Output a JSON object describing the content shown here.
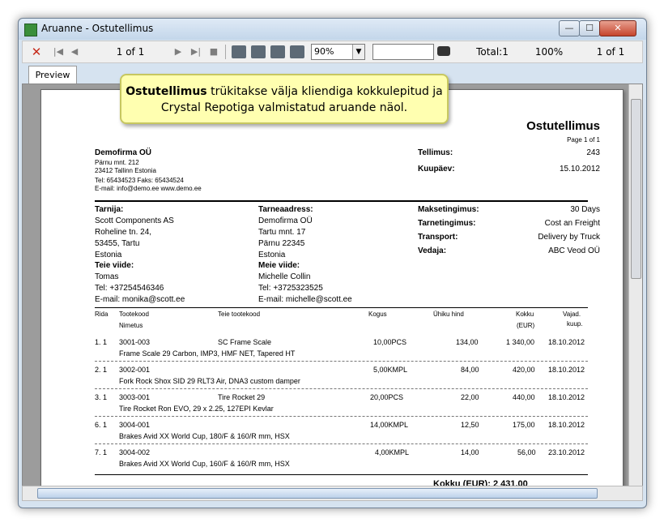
{
  "window": {
    "title": "Aruanne - Ostutellimus",
    "min": "—",
    "max": "☐",
    "close": "✕"
  },
  "toolbar": {
    "close": "✕",
    "first": "|◀",
    "prev": "◀",
    "page": "1 of 1",
    "next": "▶",
    "last": "▶|",
    "stop": "■",
    "zoom": "90%",
    "total": "Total:1",
    "percent": "100%",
    "page_of": "1 of 1"
  },
  "tab": {
    "label": "Preview"
  },
  "callout": {
    "bold": "Ostutellimus",
    "rest": "trükitakse välja kliendiga kokkulepitud ja Crystal Repotiga valmistatud aruande näol."
  },
  "report": {
    "title": "Ostutellimus",
    "page": "Page 1 of 1",
    "company": {
      "name": "Demofirma OÜ",
      "address1": "Pärnu mnt. 212",
      "address2": "23412 Tallinn Estonia",
      "phones": "Tel: 65434523   Faks: 65434524",
      "web": "E-mail: info@demo.ee     www.demo.ee"
    },
    "order_label": "Tellimus:",
    "order_no": "243",
    "date_label": "Kuupäev:",
    "date": "15.10.2012",
    "supplier": {
      "label": "Tarnija:",
      "l1": "Scott Components AS",
      "l2": "Roheline tn. 24,",
      "l3": "53455, Tartu",
      "l4": "Estonia"
    },
    "delivery": {
      "label": "Tarneaadress:",
      "l1": "Demofirma OÜ",
      "l2": "Tartu mnt. 17",
      "l3": "Pärnu 22345",
      "l4": "Estonia"
    },
    "your_ref": {
      "label": "Teie viide:",
      "name": "Tomas",
      "tel": "Tel:     +37254546346",
      "email": "E-mail: monika@scott.ee"
    },
    "our_ref": {
      "label": "Meie viide:",
      "name": "Michelle Collin",
      "tel": "Tel:     +3725323525",
      "email": "E-mail: michelle@scott.ee"
    },
    "terms": {
      "payment_label": "Maksetingimus:",
      "payment": "30 Days",
      "delivery_label": "Tarnetingimus:",
      "delivery": "Cost an Freight",
      "transport_label": "Transport:",
      "transport": "Delivery by Truck",
      "carrier_label": "Vedaja:",
      "carrier": "ABC Veod OÜ"
    },
    "columns": {
      "rida": "Rida",
      "code": "Tootekood",
      "name": "Nimetus",
      "sup_code": "Teie tootekood",
      "qty": "Kogus",
      "unit": "Ühiku hind",
      "sum": "Kokku",
      "sum_cur": "(EUR)",
      "need": "Vajad.",
      "need2": "kuup."
    },
    "rows": [
      {
        "rida": "1. 1",
        "code": "3001-003",
        "sup_code": "SC Frame Scale",
        "qty": "10,00PCS",
        "unit": "134,00",
        "sum": "1 340,00",
        "date": "18.10.2012",
        "name": "Frame Scale 29 Carbon, IMP3, HMF NET, Tapered HT"
      },
      {
        "rida": "2. 1",
        "code": "3002-001",
        "sup_code": "",
        "qty": "5,00KMPL",
        "unit": "84,00",
        "sum": "420,00",
        "date": "18.10.2012",
        "name": "Fork Rock Shox SID 29 RLT3 Air, DNA3 custom damper"
      },
      {
        "rida": "3. 1",
        "code": "3003-001",
        "sup_code": "Tire Rocket 29",
        "qty": "20,00PCS",
        "unit": "22,00",
        "sum": "440,00",
        "date": "18.10.2012",
        "name": "Tire Rocket Ron EVO, 29 x 2.25, 127EPI Kevlar"
      },
      {
        "rida": "6. 1",
        "code": "3004-001",
        "sup_code": "",
        "qty": "14,00KMPL",
        "unit": "12,50",
        "sum": "175,00",
        "date": "18.10.2012",
        "name": "Brakes Avid XX World Cup, 180/F & 160/R mm, HSX"
      },
      {
        "rida": "7. 1",
        "code": "3004-002",
        "sup_code": "",
        "qty": "4,00KMPL",
        "unit": "14,00",
        "sum": "56,00",
        "date": "23.10.2012",
        "name": "Brakes Avid XX World Cup, 160/F & 160/R mm, HSX"
      }
    ],
    "total": "Kokku (EUR): 2 431,00"
  }
}
